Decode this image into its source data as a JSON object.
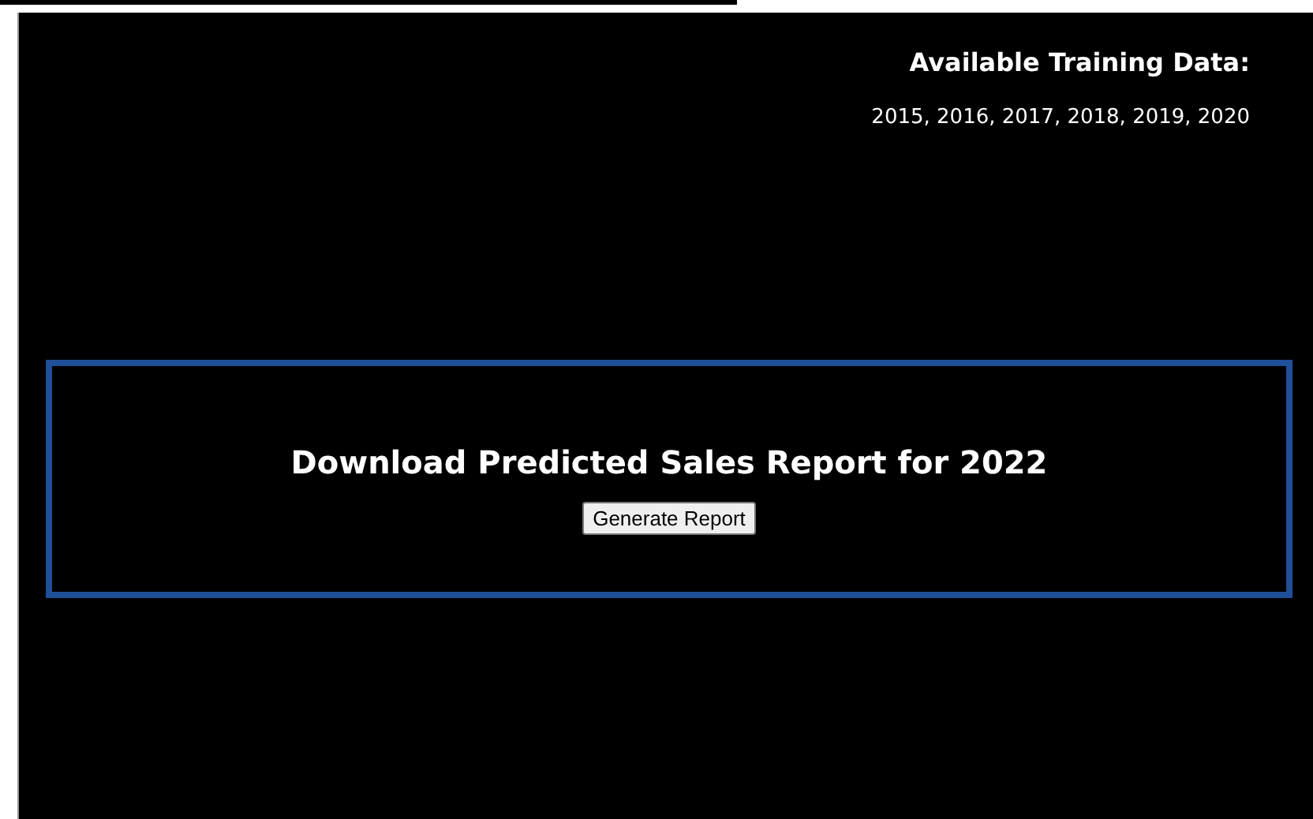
{
  "training_data": {
    "title": "Available Training Data:",
    "years": "2015, 2016, 2017, 2018, 2019, 2020"
  },
  "report": {
    "heading": "Download Predicted Sales Report for 2022",
    "button": "Generate Report"
  }
}
